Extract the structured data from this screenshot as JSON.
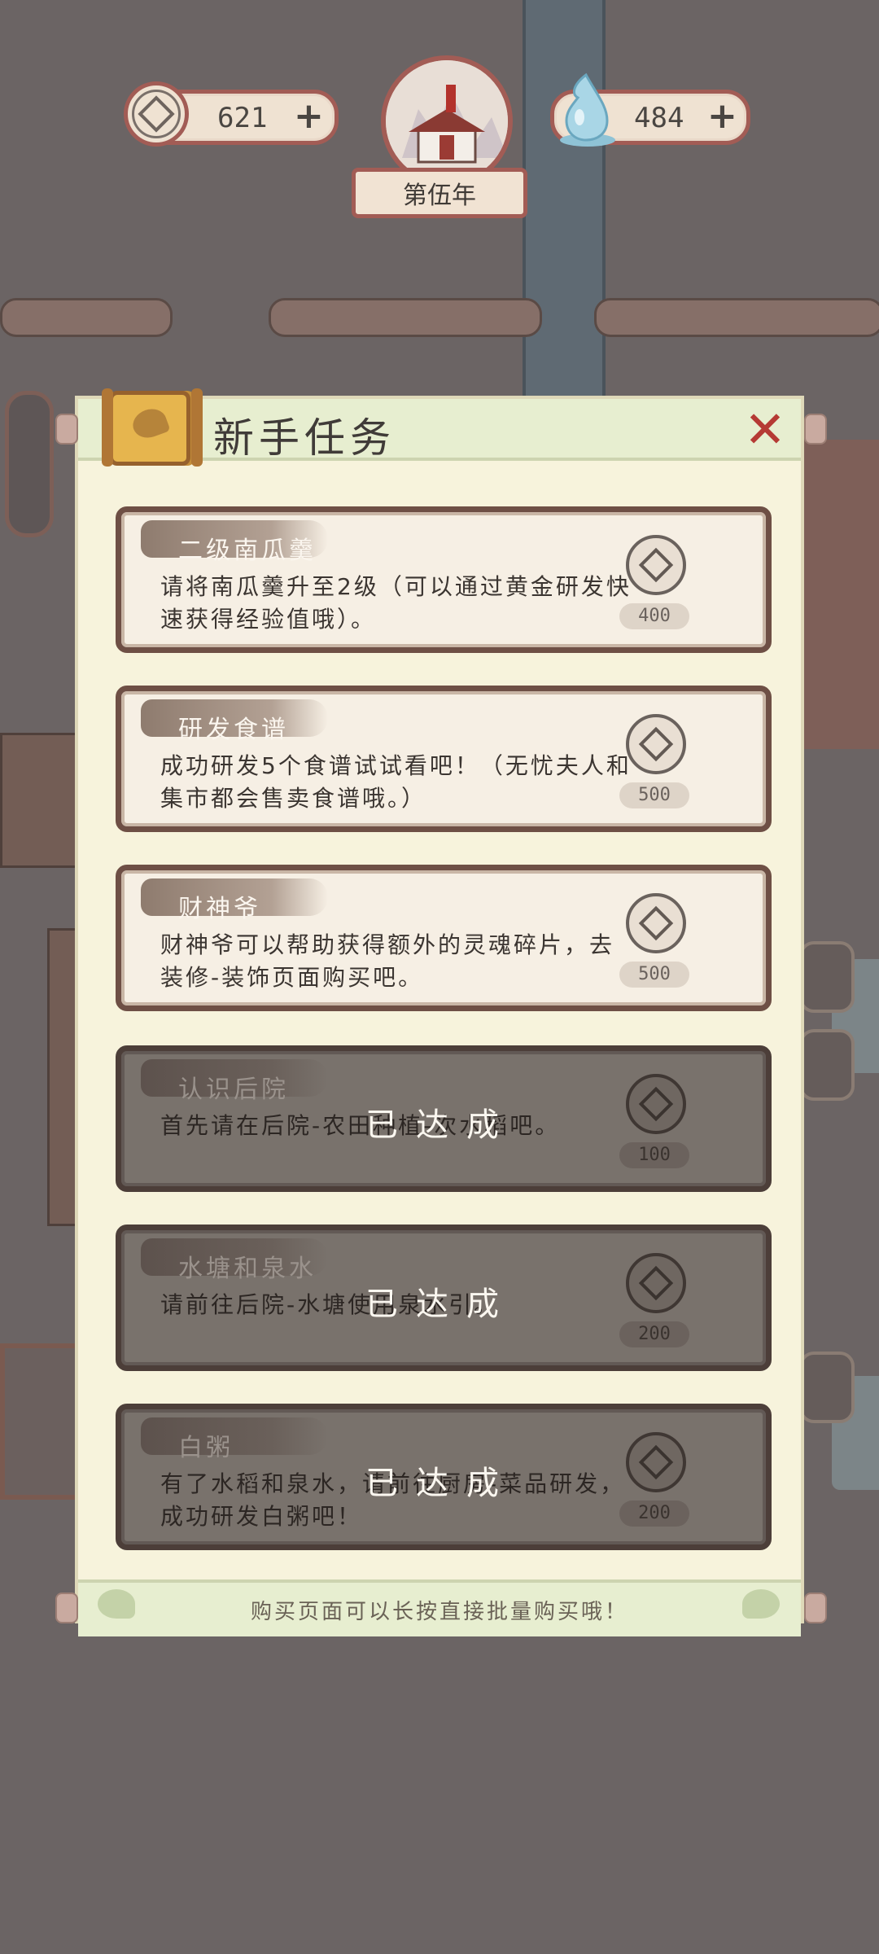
{
  "hud": {
    "coins": {
      "value": "621",
      "plus_label": "+",
      "icon": "coin-icon"
    },
    "spirit": {
      "value": "484",
      "plus_label": "+",
      "icon": "water-drop-icon"
    },
    "year_label": "第伍年"
  },
  "panel": {
    "title": "新手任务",
    "close_icon": "close-icon",
    "tasks": [
      {
        "name": "二级南瓜羹",
        "desc": "请将南瓜羹升至2级（可以通过黄金研发快速获得经验值哦）。",
        "reward": "400",
        "status": ""
      },
      {
        "name": "研发食谱",
        "desc": "成功研发5个食谱试试看吧！（无忧夫人和集市都会售卖食谱哦。）",
        "reward": "500",
        "status": ""
      },
      {
        "name": "财神爷",
        "desc": "财神爷可以帮助获得额外的灵魂碎片，去装修-装饰页面购买吧。",
        "reward": "500",
        "status": ""
      },
      {
        "name": "认识后院",
        "desc": "首先请在后院-农田种植-次水稻吧。",
        "reward": "100",
        "status": "已达成"
      },
      {
        "name": "水塘和泉水",
        "desc": "请前往后院-水塘使用泉水引。",
        "reward": "200",
        "status": "已达成"
      },
      {
        "name": "白粥",
        "desc": "有了水稻和泉水，请前往厨房-菜品研发，成功研发白粥吧！",
        "reward": "200",
        "status": "已达成"
      }
    ],
    "tip": "购买页面可以长按直接批量购买哦！"
  },
  "colors": {
    "accent_red": "#a25c55",
    "panel_bg": "#f7f3dc",
    "close_red": "#b53a34"
  }
}
